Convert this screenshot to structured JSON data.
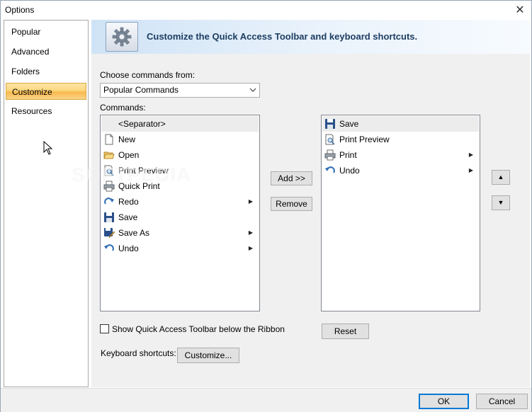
{
  "window": {
    "title": "Options"
  },
  "nav": {
    "items": [
      {
        "label": "Popular"
      },
      {
        "label": "Advanced"
      },
      {
        "label": "Folders"
      },
      {
        "label": "Customize"
      },
      {
        "label": "Resources"
      }
    ],
    "selected": "Customize"
  },
  "header": {
    "title": "Customize the Quick Access Toolbar and keyboard shortcuts."
  },
  "choose": {
    "label": "Choose commands from:",
    "value": "Popular Commands"
  },
  "commands": {
    "label": "Commands:",
    "items": [
      {
        "label": "<Separator>",
        "icon": "",
        "submenu": false
      },
      {
        "label": "New",
        "icon": "new-document-icon",
        "submenu": false
      },
      {
        "label": "Open",
        "icon": "open-folder-icon",
        "submenu": false
      },
      {
        "label": "Print Preview",
        "icon": "print-preview-icon",
        "submenu": false
      },
      {
        "label": "Quick Print",
        "icon": "printer-icon",
        "submenu": false
      },
      {
        "label": "Redo",
        "icon": "redo-icon",
        "submenu": true
      },
      {
        "label": "Save",
        "icon": "save-icon",
        "submenu": false
      },
      {
        "label": "Save As",
        "icon": "save-as-icon",
        "submenu": true
      },
      {
        "label": "Undo",
        "icon": "undo-icon",
        "submenu": true
      }
    ]
  },
  "toolbar_list": {
    "items": [
      {
        "label": "Save",
        "icon": "save-icon",
        "submenu": false
      },
      {
        "label": "Print Preview",
        "icon": "print-preview-icon",
        "submenu": false
      },
      {
        "label": "Print",
        "icon": "printer-icon",
        "submenu": true
      },
      {
        "label": "Undo",
        "icon": "undo-icon",
        "submenu": true
      }
    ]
  },
  "buttons": {
    "add": "Add >>",
    "remove": "Remove",
    "reset": "Reset",
    "customize": "Customize...",
    "ok": "OK",
    "cancel": "Cancel",
    "move_up": "▲",
    "move_down": "▼"
  },
  "options": {
    "show_below_ribbon": "Show Quick Access Toolbar below the Ribbon",
    "show_below_ribbon_checked": false,
    "keyboard_shortcuts_label": "Keyboard shortcuts:"
  },
  "watermark": "SOFTPEDIA",
  "colors": {
    "accent": "#0078d7",
    "selected_nav": "#fbd77f",
    "header_title": "#1d3d62"
  }
}
